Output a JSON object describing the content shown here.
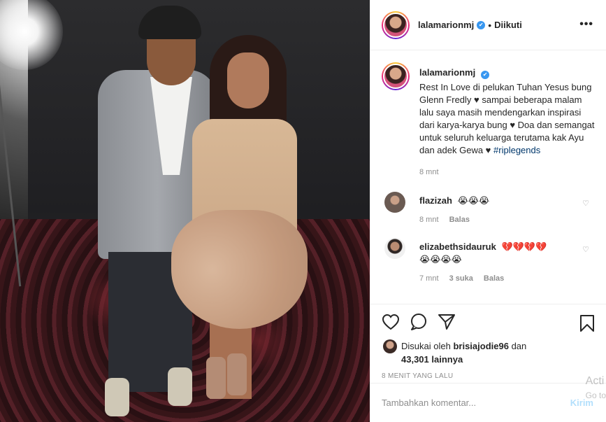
{
  "post": {
    "username": "lalamarionmj",
    "follow_status": "Diikuti",
    "more_glyph": "•••",
    "caption": "Rest In Love di pelukan Tuhan Yesus bung Glenn Fredly ♥ sampai beberapa malam lalu saya masih mendengarkan inspirasi dari karya-karya bung ♥ Doa dan semangat untuk seluruh keluarga terutama kak Ayu dan adek Gewa ♥",
    "hashtag": "#riplegends",
    "caption_time": "8 mnt"
  },
  "comments": [
    {
      "username": "flazizah",
      "text": "😭😭😭",
      "time": "8 mnt",
      "likes": "",
      "reply_label": "Balas"
    },
    {
      "username": "elizabethsidauruk",
      "text": "💔💔💔💔",
      "text_line2": "😭😭😭😭",
      "time": "7 mnt",
      "likes": "3 suka",
      "reply_label": "Balas"
    }
  ],
  "actions": {
    "like_icon": "heart-icon",
    "comment_icon": "comment-icon",
    "share_icon": "share-icon",
    "save_icon": "bookmark-icon"
  },
  "likes": {
    "prefix": "Disukai oleh",
    "user": "brisiajodie96",
    "connector": "dan",
    "others": "43,301 lainnya"
  },
  "timestamp": "8 menit yang lalu",
  "add_comment": {
    "placeholder": "Tambahkan komentar...",
    "post_label": "Kirim"
  },
  "watermark": {
    "line1": "Acti",
    "line2": "Go to"
  }
}
